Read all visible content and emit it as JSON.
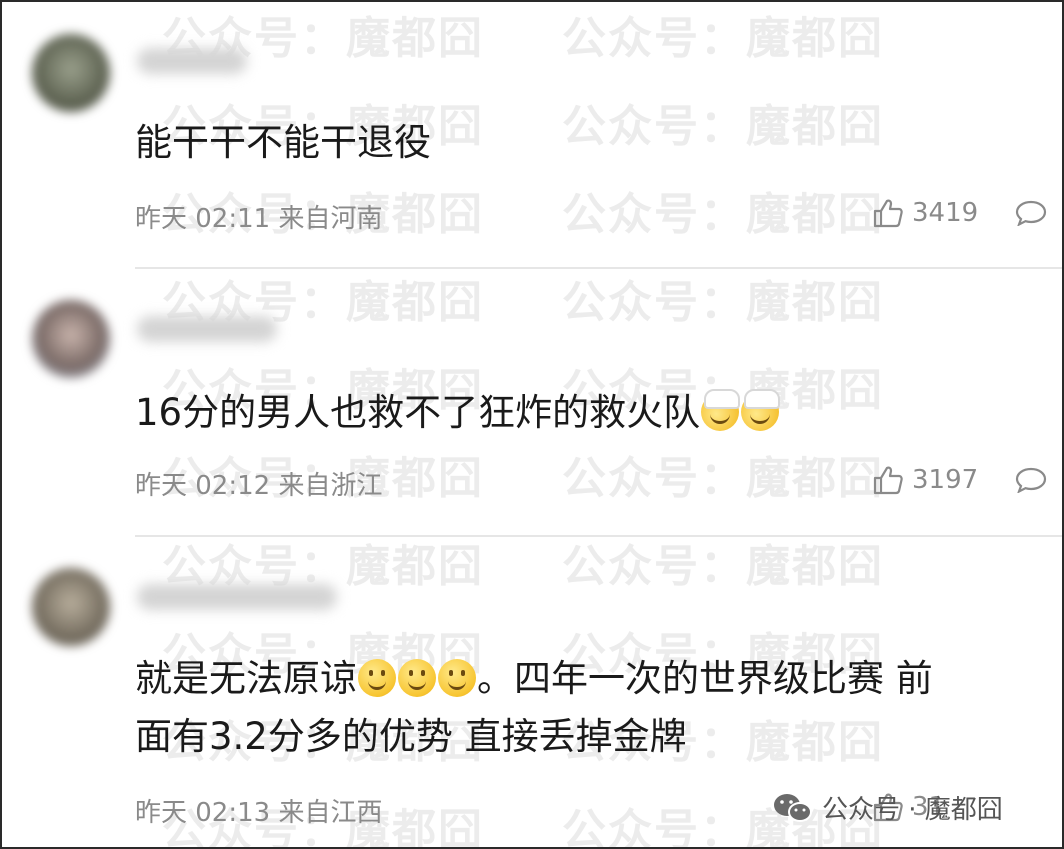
{
  "watermark": "公众号：魔都囧",
  "comments": [
    {
      "text": "能干干不能干退役",
      "time": "昨天 02:11",
      "location": "来自河南",
      "likes": "3419",
      "avatar_color": "#6b7060"
    },
    {
      "text": "16分的男人也救不了狂炸的救火队",
      "time": "昨天 02:12",
      "location": "来自浙江",
      "likes": "3197",
      "avatar_color": "#8c7c78"
    },
    {
      "text_line1": "就是无法原谅",
      "text_line1b": "。四年一次的世界级比赛 前",
      "text_line2": "面有3.2分多的优势 直接丢掉金牌",
      "time": "昨天 02:13",
      "location": "来自江西",
      "likes": "31",
      "avatar_color": "#8a8274"
    }
  ],
  "brand": {
    "label": "公众号 · 魔都囧"
  },
  "icons": [
    "thumbs-up-icon",
    "comment-bubble-icon",
    "wechat-icon"
  ]
}
